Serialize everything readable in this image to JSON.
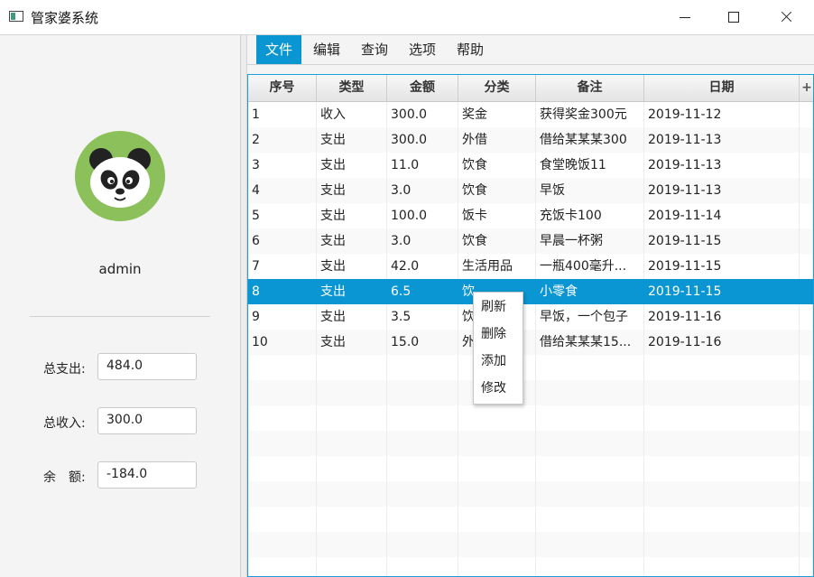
{
  "window": {
    "title": "管家婆系统"
  },
  "sidebar": {
    "username": "admin",
    "stats": [
      {
        "label": "总支出:",
        "value": "484.0"
      },
      {
        "label": "总收入:",
        "value": "300.0"
      },
      {
        "label": "余　额:",
        "value": "-184.0"
      }
    ]
  },
  "menu": [
    "文件",
    "编辑",
    "查询",
    "选项",
    "帮助"
  ],
  "table": {
    "columns": [
      "序号",
      "类型",
      "金额",
      "分类",
      "备注",
      "日期"
    ],
    "selected_index": 7,
    "rows": [
      [
        "1",
        "收入",
        "300.0",
        "奖金",
        "获得奖金300元",
        "2019-11-12"
      ],
      [
        "2",
        "支出",
        "300.0",
        "外借",
        "借给某某某300",
        "2019-11-13"
      ],
      [
        "3",
        "支出",
        "11.0",
        "饮食",
        "食堂晚饭11",
        "2019-11-13"
      ],
      [
        "4",
        "支出",
        "3.0",
        "饮食",
        "早饭",
        "2019-11-13"
      ],
      [
        "5",
        "支出",
        "100.0",
        "饭卡",
        "充饭卡100",
        "2019-11-14"
      ],
      [
        "6",
        "支出",
        "3.0",
        "饮食",
        "早晨一杯粥",
        "2019-11-15"
      ],
      [
        "7",
        "支出",
        "42.0",
        "生活用品",
        "一瓶400毫升...",
        "2019-11-15"
      ],
      [
        "8",
        "支出",
        "6.5",
        "饮",
        "小零食",
        "2019-11-15"
      ],
      [
        "9",
        "支出",
        "3.5",
        "饮",
        "早饭，一个包子",
        "2019-11-16"
      ],
      [
        "10",
        "支出",
        "15.0",
        "外",
        "借给某某某15...",
        "2019-11-16"
      ]
    ]
  },
  "context_menu": [
    "刷新",
    "删除",
    "添加",
    "修改"
  ],
  "colors": {
    "accent": "#0a96d2",
    "avatar_bg": "#8bc05a"
  },
  "icons": [
    "app-icon",
    "minimize-icon",
    "maximize-icon",
    "close-icon",
    "panda-avatar-icon",
    "column-plus-icon"
  ]
}
